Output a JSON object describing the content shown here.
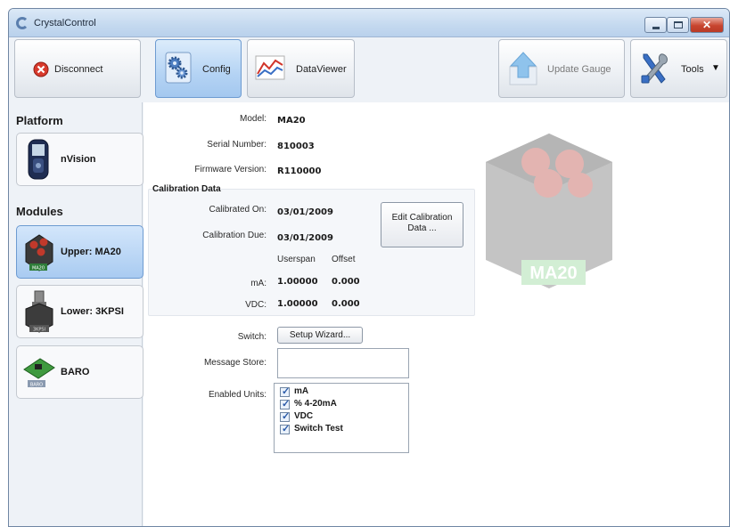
{
  "window": {
    "title": "CrystalControl"
  },
  "toolbar": {
    "disconnect_label": "Disconnect",
    "config_label": "Config",
    "dataviewer_label": "DataViewer",
    "update_gauge_label": "Update Gauge",
    "tools_label": "Tools"
  },
  "sidebar": {
    "platform_heading": "Platform",
    "platform_item": "nVision",
    "modules_heading": "Modules",
    "modules": [
      {
        "label": "Upper: MA20",
        "badge": "MA20"
      },
      {
        "label": "Lower: 3KPSI",
        "badge": "3KPSI"
      },
      {
        "label": "BARO",
        "badge": "BARO"
      }
    ]
  },
  "config": {
    "model_label": "Model:",
    "model_value": "MA20",
    "serial_label": "Serial Number:",
    "serial_value": "810003",
    "firmware_label": "Firmware Version:",
    "firmware_value": "R110000",
    "calibration": {
      "title": "Calibration Data",
      "calibrated_on_label": "Calibrated On:",
      "calibrated_on_value": "03/01/2009",
      "calibration_due_label": "Calibration Due:",
      "calibration_due_value": "03/01/2009",
      "edit_button_line1": "Edit Calibration",
      "edit_button_line2": "Data ...",
      "col_userspan": "Userspan",
      "col_offset": "Offset",
      "rows": [
        {
          "label": "mA:",
          "userspan": "1.00000",
          "offset": "0.000"
        },
        {
          "label": "VDC:",
          "userspan": "1.00000",
          "offset": "0.000"
        }
      ]
    },
    "switch_label": "Switch:",
    "setup_wizard_label": "Setup Wizard...",
    "message_store_label": "Message Store:",
    "message_store_value": "",
    "enabled_units_label": "Enabled Units:",
    "units": [
      "mA",
      "% 4-20mA",
      "VDC",
      "Switch Test"
    ],
    "device_image_label": "MA20"
  },
  "colors": {
    "selected_tab": "#b4d3f4",
    "device_badge": "#7fcf86",
    "close_button": "#c8452f"
  }
}
